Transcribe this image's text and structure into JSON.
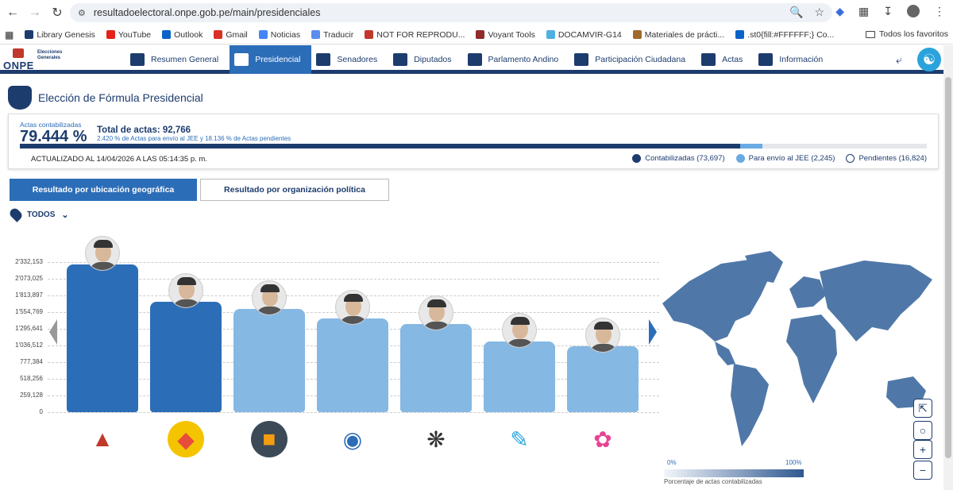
{
  "browser": {
    "url": "resultadoelectoral.onpe.gob.pe/main/presidenciales",
    "bookmarks": [
      "Library Genesis",
      "YouTube",
      "Outlook",
      "Gmail",
      "Noticias",
      "Traducir",
      "NOT FOR REPRODU...",
      "Voyant Tools",
      "DOCAMVIR-G14",
      "Materiales de prácti...",
      ".st0{fill:#FFFFFF;} Co..."
    ],
    "bookmarks_all": "Todos los favoritos"
  },
  "header": {
    "logo": "ONPE",
    "logo_sub1": "Elecciones",
    "logo_sub2": "Generales",
    "nav": [
      "Resumen General",
      "Presidencial",
      "Senadores",
      "Diputados",
      "Parlamento Andino",
      "Participación Ciudadana",
      "Actas",
      "Información"
    ],
    "active_nav": "Presidencial"
  },
  "page": {
    "title": "Elección de Fórmula Presidencial"
  },
  "summary": {
    "actas_label": "Actas contabilizadas",
    "actas_pct": "79.444 %",
    "total_actas": "Total de actas: 92,766",
    "pct_note": "2.420 % de Actas para envío al JEE y 18.136 % de Actas pendientes",
    "updated": "ACTUALIZADO AL 14/04/2026 A LAS 05:14:35 p. m.",
    "progress_contabilizadas": 79.444,
    "progress_jee": 2.42,
    "legend": [
      {
        "label": "Contabilizadas (73,697)",
        "color": "#1d3c6e"
      },
      {
        "label": "Para envío al JEE (2,245)",
        "color": "#6aaae4"
      },
      {
        "label": "Pendientes (16,824)",
        "color": "#ffffff"
      }
    ]
  },
  "tabs": [
    "Resultado por ubicación geográfica",
    "Resultado por organización política"
  ],
  "filter": {
    "label": "TODOS"
  },
  "chart_data": {
    "type": "bar",
    "yticks": [
      "2'332,153",
      "2'073,025",
      "1'813,897",
      "1'554,769",
      "1'295,641",
      "1'036,512",
      "777,384",
      "518,256",
      "259,128",
      "0"
    ],
    "ylim": [
      0,
      2332153
    ],
    "values": [
      2290000,
      1720000,
      1600000,
      1460000,
      1370000,
      1100000,
      1030000
    ],
    "colors": [
      "#2c6db8",
      "#2c6db8",
      "#85b8e3",
      "#85b8e3",
      "#85b8e3",
      "#85b8e3",
      "#85b8e3"
    ],
    "party_icons": [
      "triangle-logo-icon",
      "diamond-logo-icon",
      "bag-logo-icon",
      "spiral-logo-icon",
      "ant-logo-icon",
      "speech-bubble-logo-icon",
      "flower-logo-icon"
    ]
  },
  "map": {
    "scale_min": "0%",
    "scale_max": "100%",
    "scale_caption": "Porcentaje de actas contabilizadas"
  }
}
